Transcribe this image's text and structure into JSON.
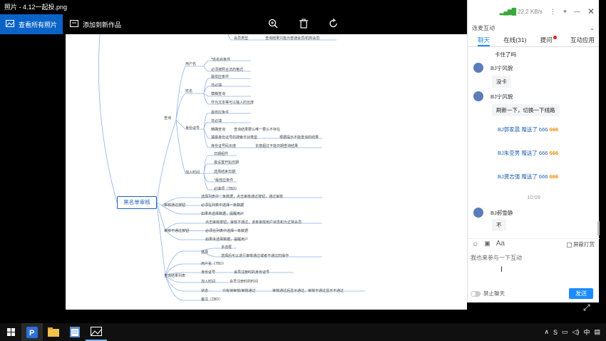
{
  "window": {
    "title": "照片 - 4.12一起投.png"
  },
  "toolbar": {
    "view_all": "查看所有照片",
    "add_to": "添加到新作品"
  },
  "mindmap": {
    "root": "黑名单审核",
    "nodes": [
      "会员类型",
      "查询结果只能为普通会员/机构会员",
      "用户名",
      "*姓名完条件",
      "必须按照合法的格式",
      "姓名",
      "最低应条件",
      "非必填",
      "模糊查询",
      "作为文本等可以输入的长度",
      "查询",
      "身份证号",
      "最低应条件",
      "非必填",
      "精确查询",
      "查询结果要么唯一要么不存在",
      "填报身份证号的搜索不对类型",
      "根据提示不能查询的结果",
      "身份证号码长度",
      "长度超过不能日期查询结果",
      "加入时间",
      "日期组件",
      "最设置开始日期",
      "选择结束日期",
      "*最低应条件",
      "必填项（TBD）",
      "审核通过按钮",
      "选择列表中一条数据，点击审核通过按钮，通过审核",
      "必须在列表中选择一条数据",
      "如果未选择数据，提醒用户",
      "审核不通过按钮",
      "点击审核按钮，审核不通过，该条审核用户状态和为正常会员",
      "必须在列表中选择一条数据",
      "如果未选择数据，提醒用户",
      "查询结果列表",
      "选择",
      "多选框",
      "选择后可以进行审核通过或者不通过的操作",
      "用户名（TBD）",
      "身份证号",
      "会员注册时的身份证号",
      "加入时间",
      "会员注册时的时间",
      "状态",
      "只有待审核/审核通过",
      "审核通过后显示通过，审核不通过显示不通过",
      "备注（TBD）"
    ]
  },
  "chat": {
    "network_speed": "22.2 KB/s",
    "room": "连麦互动",
    "tabs": [
      "聊天",
      "在线(31)",
      "提问",
      "互动应用"
    ],
    "first_line": "卡住了吗",
    "messages": [
      {
        "sender": "BJ宁风貌",
        "text": "没卡"
      },
      {
        "sender": "BJ宁风貌",
        "text": "刷新一下，切换一下线路"
      }
    ],
    "gifts": [
      {
        "text": "BJ郭家晨 赠送了 666",
        "badge": "666"
      },
      {
        "text": "BJ朱亚男 赠送了 666",
        "badge": "666"
      },
      {
        "text": "BJ龚志强 赠送了 666",
        "badge": "666"
      }
    ],
    "timestamp": "10:09",
    "last_message": {
      "sender": "BJ郝雪静",
      "text": "不"
    },
    "mute_label": "屏蔽打赏",
    "input_placeholder": "我也来参与一下互动",
    "ban_label": "禁止聊天",
    "send_label": "发送"
  },
  "taskbar": {
    "ime": "中",
    "tray_label": "S"
  }
}
